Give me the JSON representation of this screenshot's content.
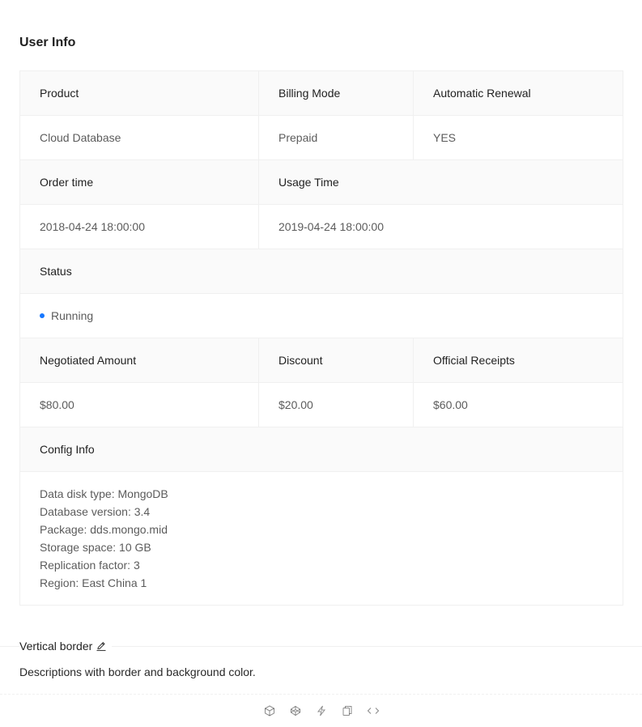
{
  "descriptions": {
    "title": "User Info",
    "row1_labels": [
      "Product",
      "Billing Mode",
      "Automatic Renewal"
    ],
    "row1_values": [
      "Cloud Database",
      "Prepaid",
      "YES"
    ],
    "row2_labels": [
      "Order time",
      "Usage Time"
    ],
    "row2_values": [
      "2018-04-24 18:00:00",
      "2019-04-24 18:00:00"
    ],
    "status_label": "Status",
    "status_value": "Running",
    "status_color": "#1677ff",
    "row4_labels": [
      "Negotiated Amount",
      "Discount",
      "Official Receipts"
    ],
    "row4_values": [
      "$80.00",
      "$20.00",
      "$60.00"
    ],
    "config_label": "Config Info",
    "config_lines": [
      "Data disk type: MongoDB",
      "Database version: 3.4",
      "Package: dds.mongo.mid",
      "Storage space: 10 GB",
      "Replication factor: 3",
      "Region: East China 1"
    ]
  },
  "demo_meta": {
    "title": "Vertical border",
    "description": "Descriptions with border and background color.",
    "actions": [
      "codesandbox-icon",
      "codepen-icon",
      "stackblitz-icon",
      "copy-icon",
      "expand-code-icon"
    ]
  }
}
